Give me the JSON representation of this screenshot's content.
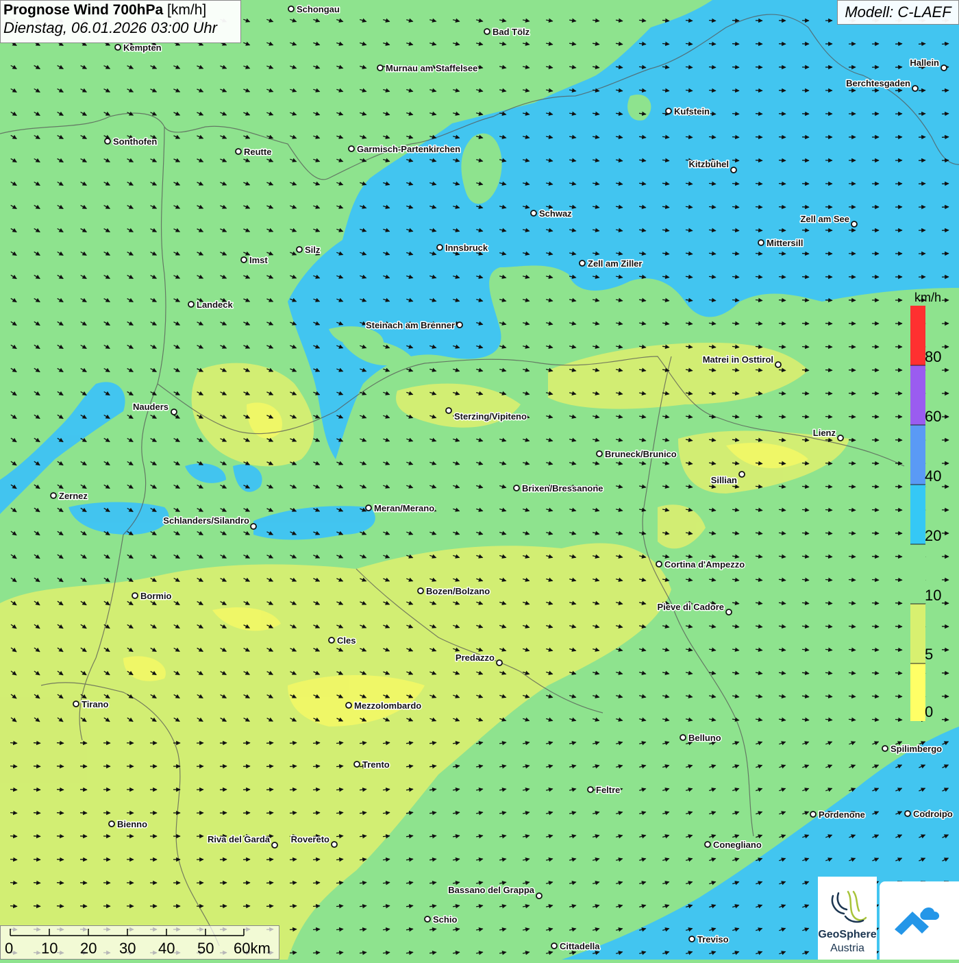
{
  "title": {
    "bold": "Prognose Wind 700hPa",
    "unit": "[km/h]",
    "datetime": "Dienstag, 06.01.2026 03:00 Uhr"
  },
  "model_label": "Modell: C-LAEF",
  "legend": {
    "unit": "km/h",
    "ticks": [
      "80",
      "60",
      "40",
      "20",
      "10",
      "5",
      "0"
    ],
    "colors": [
      "#ff3030",
      "#9a5cf0",
      "#5a9af5",
      "#35c8f5",
      "#8ee38e",
      "#d8f070",
      "#ffff66"
    ]
  },
  "scale_bar": {
    "labels": [
      "0",
      "10",
      "20",
      "30",
      "40",
      "50",
      "60km"
    ]
  },
  "logo": {
    "text1": "GeoSphere",
    "text2": "Austria"
  },
  "cities": [
    "Schongau",
    "Bad Tölz",
    "Kempten",
    "Murnau am Staffelsee",
    "Hallein",
    "Berchtesgaden",
    "Kufstein",
    "Sonthofen",
    "Reutte",
    "Garmisch-Partenkirchen",
    "Kitzbühel",
    "Schwaz",
    "Zell am See",
    "Mittersill",
    "Innsbruck",
    "Silz",
    "Imst",
    "Zell am Ziller",
    "Landeck",
    "Steinach am Brenner",
    "Matrei in Osttirol",
    "Nauders",
    "Sterzing/Vipiteno",
    "Lienz",
    "Bruneck/Brunico",
    "Sillian",
    "Brixen/Bressanone",
    "Zernez",
    "Meran/Merano",
    "Schlanders/Silandro",
    "Cortina d'Ampezzo",
    "Bozen/Bolzano",
    "Bormio",
    "Pieve di Cadore",
    "Cles",
    "Predazzo",
    "Tirano",
    "Mezzolombardo",
    "Belluno",
    "Spilimbergo",
    "Trento",
    "Feltre",
    "Bienno",
    "Pordenone",
    "Codroipo",
    "Riva del Garda",
    "Rovereto",
    "Conegliano",
    "Bassano del Grappa",
    "Schio",
    "Treviso",
    "Cittadella"
  ]
}
